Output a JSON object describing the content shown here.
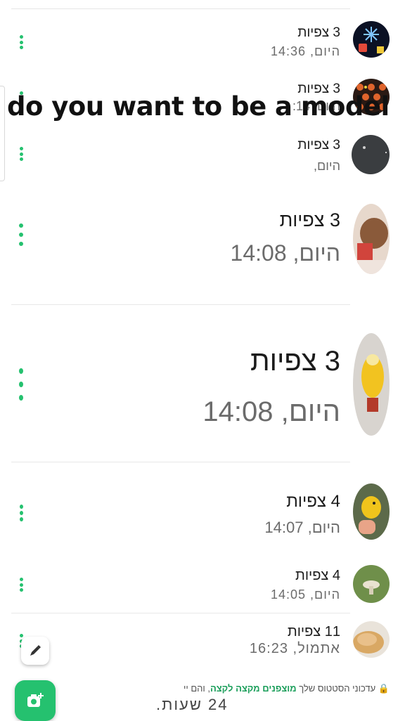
{
  "overlay_text": "do you want to be a model",
  "status_items": [
    {
      "views": "3 צפיות",
      "time": "היום, 14:36",
      "avatar": "snowflake-game-thumbnail"
    },
    {
      "views": "3 צפיות",
      "time": "היום, 14:",
      "avatar": "colorful-pattern-thumbnail"
    },
    {
      "views": "3 צפיות",
      "time": "היום, ",
      "avatar": "dark-round-thumbnail"
    },
    {
      "views": "3 צפיות",
      "time": "היום, 14:08",
      "avatar": "plush-toy-thumbnail"
    },
    {
      "views": "3 צפיות",
      "time": "היום, 14:08",
      "avatar": "yellow-plush-thumbnail"
    },
    {
      "views": "4 צפיות",
      "time": "היום, 14:07",
      "avatar": "yellow-bird-thumbnail"
    },
    {
      "views": "4 צפיות",
      "time": "היום, 14:05",
      "avatar": "mushroom-grass-thumbnail"
    },
    {
      "views": "11 צפיות",
      "time": "אתמול, 16:23",
      "avatar": "bread-thumbnail"
    }
  ],
  "footer": {
    "notice_prefix": "עדכוני הסטטוס שלך",
    "notice_link": "מוצפנים מקצה לקצה",
    "notice_suffix": ", והם יי",
    "notice_line2": "24 שעות."
  },
  "colors": {
    "accent": "#25c16f",
    "link": "#1a9e5a"
  },
  "icons": {
    "pencil": "pencil-icon",
    "camera": "camera-add-icon",
    "lock": "lock-icon",
    "menu": "more-vertical-icon"
  }
}
